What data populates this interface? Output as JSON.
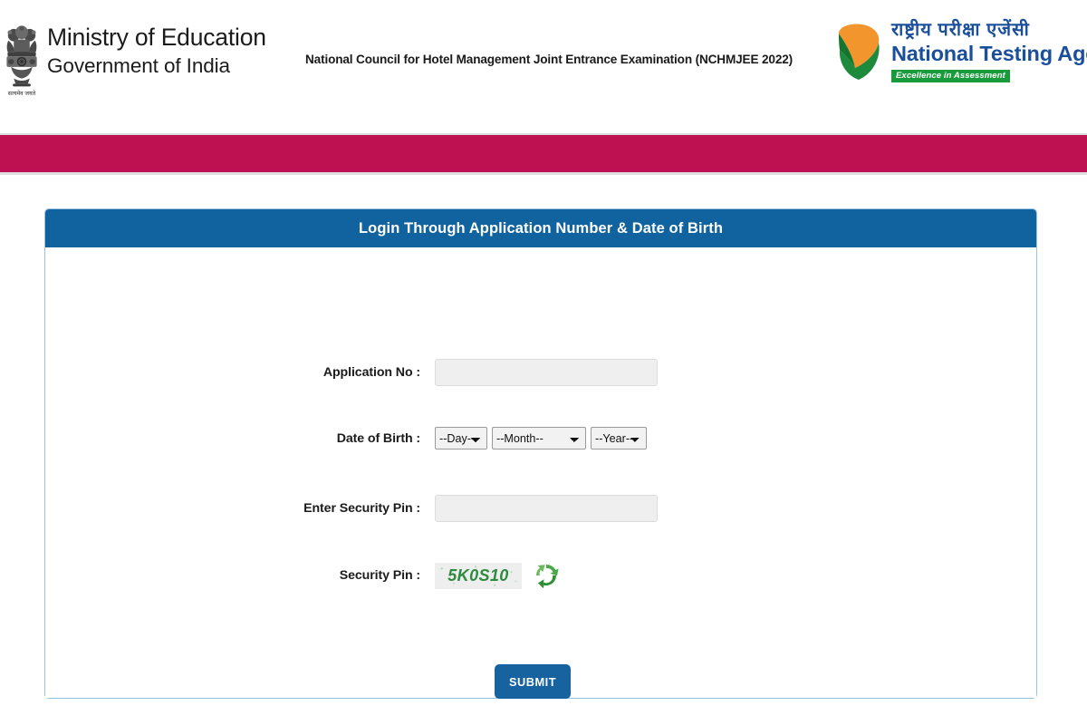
{
  "header": {
    "ministry": {
      "emblem_icon": "ashoka-emblem-icon",
      "line1": "Ministry of Education",
      "line2": "Government of India",
      "motto": "सत्यमेव जयते"
    },
    "exam_title": "National Council for Hotel Management Joint Entrance Examination (NCHMJEE 2022)",
    "nta": {
      "logo_icon": "nta-checkmark-icon",
      "hindi_name": "राष्ट्रीय परीक्षा एजेंसी",
      "english_name": "National Testing Agency",
      "tagline": "Excellence in Assessment"
    }
  },
  "nav_bar": {
    "color": "#bd1152"
  },
  "login_panel": {
    "title": "Login Through Application Number & Date of Birth",
    "header_color": "#10639f",
    "fields": {
      "application_no": {
        "label": "Application No :",
        "value": "",
        "placeholder": ""
      },
      "date_of_birth": {
        "label": "Date of Birth :",
        "day": "--Day--",
        "month": "--Month--",
        "year": "--Year--"
      },
      "enter_security_pin": {
        "label": "Enter Security Pin :",
        "value": "",
        "placeholder": ""
      },
      "security_pin": {
        "label": "Security Pin :",
        "captcha_text": "5K0S10",
        "captcha_color": "#2e8b3e",
        "refresh_icon": "refresh-captcha-icon"
      }
    },
    "submit_label": "SUBMIT",
    "submit_color": "#16639f"
  }
}
